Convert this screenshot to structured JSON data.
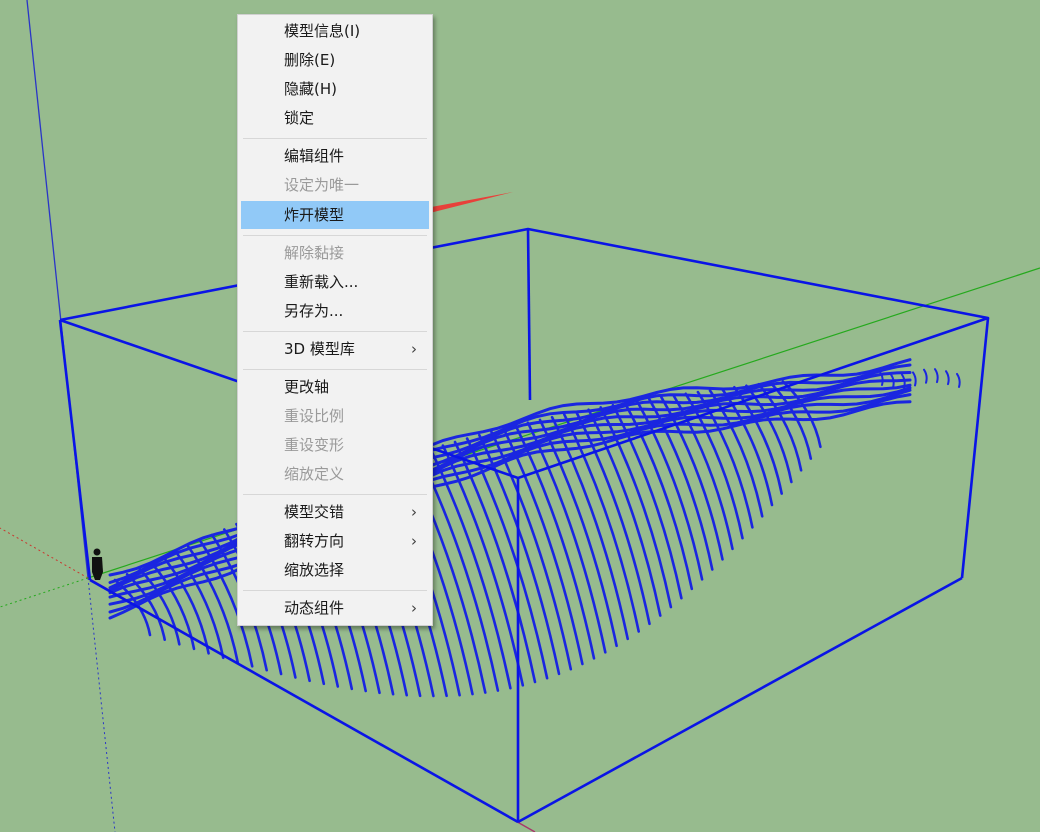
{
  "colors": {
    "viewport_background": "#97bb8e",
    "bounding_box": "#0a14e6",
    "terrain": "#1a26e0",
    "axis_red": "#c8382f",
    "axis_green": "#25a91d",
    "axis_blue": "#2a35c7",
    "menu_background": "#f2f2f2",
    "menu_highlight": "#91c9f7",
    "arrow": "#e8403a"
  },
  "context_menu": {
    "items": [
      {
        "label": "模型信息(I)",
        "disabled": false
      },
      {
        "label": "删除(E)",
        "disabled": false
      },
      {
        "label": "隐藏(H)",
        "disabled": false
      },
      {
        "label": "锁定",
        "disabled": false
      },
      {
        "label": "编辑组件",
        "disabled": false
      },
      {
        "label": "设定为唯一",
        "disabled": true
      },
      {
        "label": "炸开模型",
        "disabled": false,
        "highlighted": true
      },
      {
        "label": "解除黏接",
        "disabled": true
      },
      {
        "label": "重新载入...",
        "disabled": false
      },
      {
        "label": "另存为...",
        "disabled": false
      },
      {
        "label": "3D 模型库",
        "disabled": false,
        "submenu": true
      },
      {
        "label": "更改轴",
        "disabled": false
      },
      {
        "label": "重设比例",
        "disabled": true
      },
      {
        "label": "重设变形",
        "disabled": true
      },
      {
        "label": "缩放定义",
        "disabled": true
      },
      {
        "label": "模型交错",
        "disabled": false,
        "submenu": true
      },
      {
        "label": "翻转方向",
        "disabled": false,
        "submenu": true
      },
      {
        "label": "缩放选择",
        "disabled": false
      },
      {
        "label": "动态组件",
        "disabled": false,
        "submenu": true
      }
    ],
    "submenu_glyph": "›"
  },
  "icons": {
    "viewport_figure": "person-figure-icon",
    "annotation_arrow": "red-arrow-icon",
    "submenu": "chevron-right-icon"
  }
}
